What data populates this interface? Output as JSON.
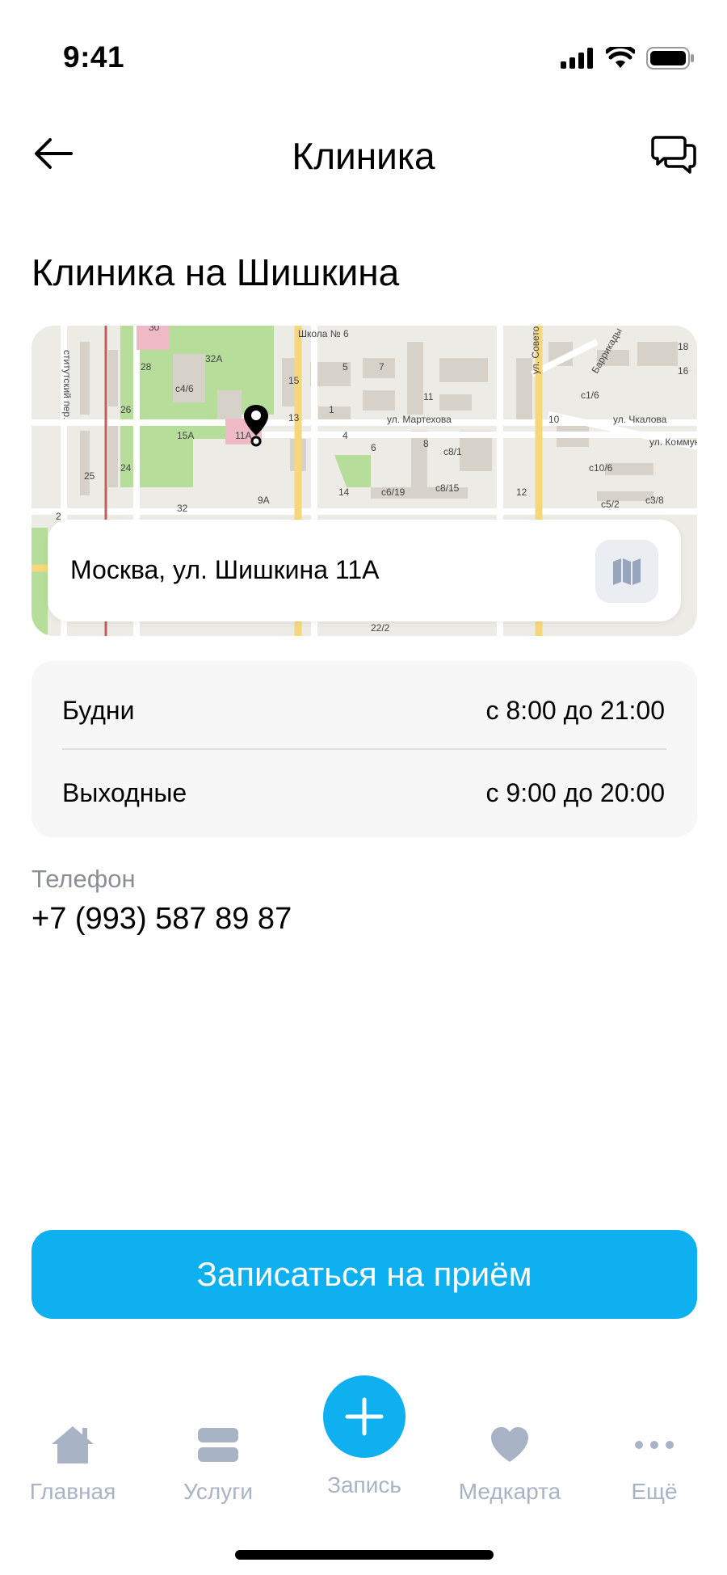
{
  "status_bar": {
    "time": "9:41"
  },
  "header": {
    "title": "Клиника"
  },
  "clinic": {
    "name": "Клиника на Шишкина",
    "address": "Москва, ул. Шишкина 11А"
  },
  "map": {
    "labels": [
      "Школа № 6",
      "ул. Советов",
      "ул. Мартехова",
      "ул. Чкалова",
      "ул. Коммун",
      "Баррикады",
      "32А",
      "15А",
      "11А",
      "с4/6",
      "с8/1",
      "с6/19",
      "с8/15",
      "с10/6",
      "с5/2",
      "с3/8",
      "с1/6",
      "9А",
      "22/2",
      "28",
      "26",
      "24",
      "25",
      "32",
      "15",
      "13",
      "11",
      "10",
      "8",
      "6",
      "5",
      "4",
      "7",
      "1",
      "2",
      "ститутский пер.",
      "30",
      "18",
      "16",
      "14",
      "12"
    ]
  },
  "hours": [
    {
      "label": "Будни",
      "value": "с 8:00 до 21:00"
    },
    {
      "label": "Выходные",
      "value": "с 9:00 до 20:00"
    }
  ],
  "phone": {
    "label": "Телефон",
    "value": "+7 (993) 587 89 87"
  },
  "cta": {
    "label": "Записаться на приём"
  },
  "tabbar": {
    "items": [
      {
        "label": "Главная",
        "icon": "home-icon"
      },
      {
        "label": "Услуги",
        "icon": "services-icon"
      },
      {
        "label": "Запись",
        "icon": "plus-icon"
      },
      {
        "label": "Медкарта",
        "icon": "heart-icon"
      },
      {
        "label": "Ещё",
        "icon": "more-icon"
      }
    ]
  },
  "colors": {
    "accent": "#0fb0ef",
    "tab_inactive": "#a8b3c6",
    "card_bg": "#f7f7f7"
  }
}
